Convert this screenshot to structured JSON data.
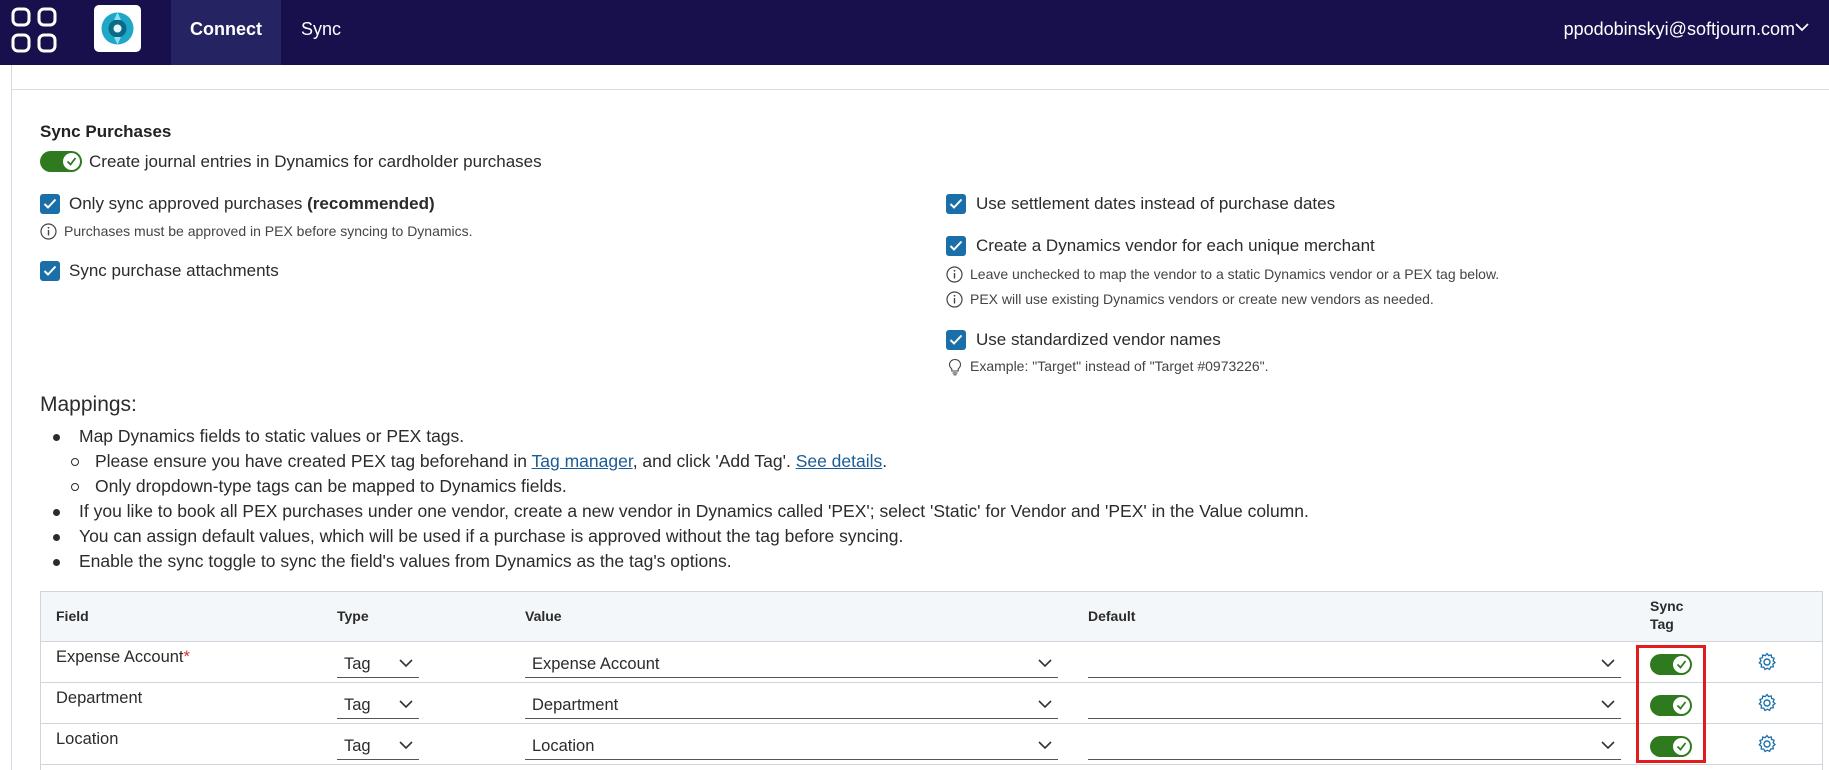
{
  "nav": {
    "waffle_icon": "app-launcher-icon",
    "app_logo_icon": "dynamics-connector-logo-icon",
    "tabs": [
      {
        "label": "Connect",
        "active": true
      },
      {
        "label": "Sync",
        "active": false
      }
    ],
    "user": "ppodobinskyi@softjourn.com"
  },
  "sync_purchases": {
    "title": "Sync Purchases",
    "toggle_label": "Create journal entries in Dynamics for cardholder purchases",
    "toggle_on": true,
    "left_options": {
      "approved_label": "Only sync approved purchases",
      "approved_suffix": "(recommended)",
      "approved_checked": true,
      "approved_hint": "Purchases must be approved in PEX before syncing to Dynamics.",
      "attachments_label": "Sync purchase attachments",
      "attachments_checked": true
    },
    "right_options": {
      "settlement_label": "Use settlement dates instead of purchase dates",
      "settlement_checked": true,
      "vendor_label": "Create a Dynamics vendor for each unique merchant",
      "vendor_checked": true,
      "vendor_hint_1": "Leave unchecked to map the vendor to a static Dynamics vendor or a PEX tag below.",
      "vendor_hint_2": "PEX will use existing Dynamics vendors or create new vendors as needed.",
      "standardized_label": "Use standardized vendor names",
      "standardized_checked": true,
      "standardized_hint": "Example: \"Target\" instead of \"Target #0973226\"."
    }
  },
  "mappings": {
    "title": "Mappings:",
    "b1": "Map Dynamics fields to static values or PEX tags.",
    "b1a_pre": "Please ensure you have created PEX tag beforehand in ",
    "b1a_link1": "Tag manager",
    "b1a_mid": ", and click 'Add Tag'. ",
    "b1a_link2": "See details",
    "b1a_post": ".",
    "b1b": "Only dropdown-type tags can be mapped to Dynamics fields.",
    "b2": "If you like to book all PEX purchases under one vendor, create a new vendor in Dynamics called 'PEX'; select 'Static' for Vendor and 'PEX' in the Value column.",
    "b3": "You can assign default values, which will be used if a purchase is approved without the tag before syncing.",
    "b4": "Enable the sync toggle to sync the field's values from Dynamics as the tag's options."
  },
  "table": {
    "headers": {
      "field": "Field",
      "type": "Type",
      "value": "Value",
      "default": "Default",
      "sync_tag_1": "Sync",
      "sync_tag_2": "Tag"
    },
    "rows": [
      {
        "field": "Expense Account",
        "required": "*",
        "type": "Tag",
        "value": "Expense Account",
        "default": "",
        "sync": true
      },
      {
        "field": "Department",
        "required": "",
        "type": "Tag",
        "value": "Department",
        "default": "",
        "sync": true
      },
      {
        "field": "Location",
        "required": "",
        "type": "Tag",
        "value": "Location",
        "default": "",
        "sync": true
      }
    ]
  },
  "colors": {
    "nav_bg": "#17104d",
    "toggle_on": "#2f7a1f",
    "checkbox": "#1b6fa8",
    "link": "#1b5c96",
    "highlight": "#e01c1c"
  }
}
